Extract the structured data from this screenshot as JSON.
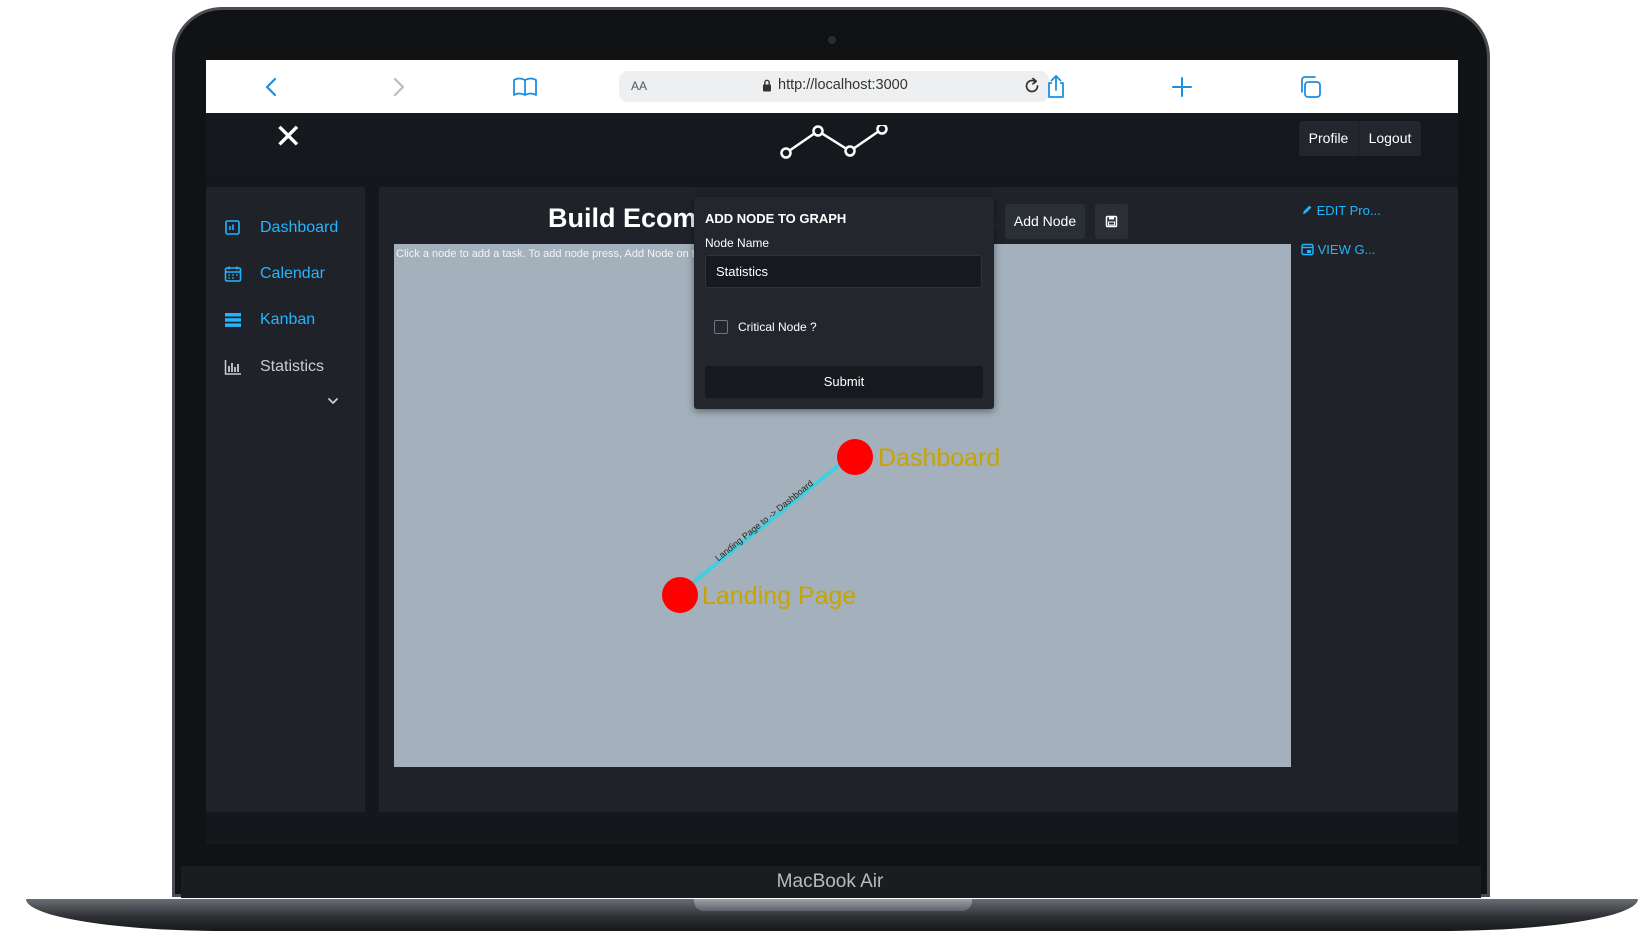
{
  "device": {
    "brand_label": "MacBook Air"
  },
  "browser": {
    "reader_label": "AA",
    "url": "http://localhost:3000"
  },
  "header": {
    "profile_label": "Profile",
    "logout_label": "Logout"
  },
  "sidebar": {
    "items": [
      {
        "label": "Dashboard",
        "color": "#22b5ff",
        "icon": "dashboard-icon"
      },
      {
        "label": "Calendar",
        "color": "#22b5ff",
        "icon": "calendar-icon"
      },
      {
        "label": "Kanban",
        "color": "#22b5ff",
        "icon": "kanban-icon"
      },
      {
        "label": "Statistics",
        "color": "#c9ccd3",
        "icon": "bar-chart-icon"
      }
    ]
  },
  "main": {
    "title": "Build Ecomm",
    "hint": "Click a node to add a task. To add node press, Add Node on t",
    "add_node_label": "Add Node",
    "edit_link": "EDIT Pro...",
    "view_link": "VIEW G..."
  },
  "graph": {
    "nodes": [
      {
        "id": "dashboard",
        "label": "Dashboard",
        "color": "#ff0000"
      },
      {
        "id": "landing",
        "label": "Landing Page",
        "color": "#ff0000"
      }
    ],
    "edges": [
      {
        "from": "landing",
        "to": "dashboard",
        "label": "Landing Page to -> Dashboard",
        "color": "#3fd0e0"
      }
    ],
    "label_color": "#c8a400"
  },
  "popover": {
    "title": "ADD NODE TO GRAPH",
    "field_label": "Node Name",
    "field_value": "Statistics",
    "checkbox_label": "Critical Node ?",
    "checkbox_checked": false,
    "submit_label": "Submit"
  },
  "colors": {
    "accent": "#22b5ff",
    "app_bg": "#1f2329",
    "canvas_bg": "#a4b0bc"
  }
}
